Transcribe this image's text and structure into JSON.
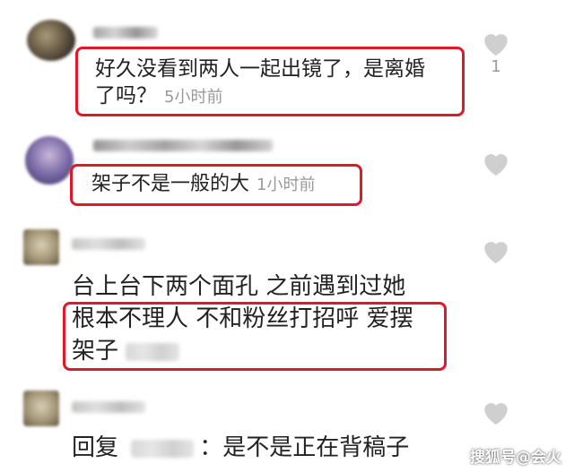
{
  "comments": [
    {
      "text": "好久没看到两人一起出镜了，是离婚",
      "text_line2": "了吗？",
      "time": "5小时前",
      "like_count": "1",
      "icon": "heart-icon"
    },
    {
      "text": "架子不是一般的大",
      "time": "1小时前",
      "icon": "heart-icon"
    },
    {
      "lines": [
        "台上台下两个面孔 之前遇到过她",
        "根本不理人 不和粉丝打招呼 爱摆",
        "架子"
      ],
      "icon": "heart-icon"
    },
    {
      "reply_prefix": "回复",
      "reply_text": "：是不是正在背稿子",
      "icon": "heart-icon"
    }
  ],
  "watermark": "搜狐号@会火",
  "colors": {
    "highlight": "#e0182b",
    "muted": "#999999",
    "text": "#222222",
    "heart": "#cfcfcf"
  }
}
